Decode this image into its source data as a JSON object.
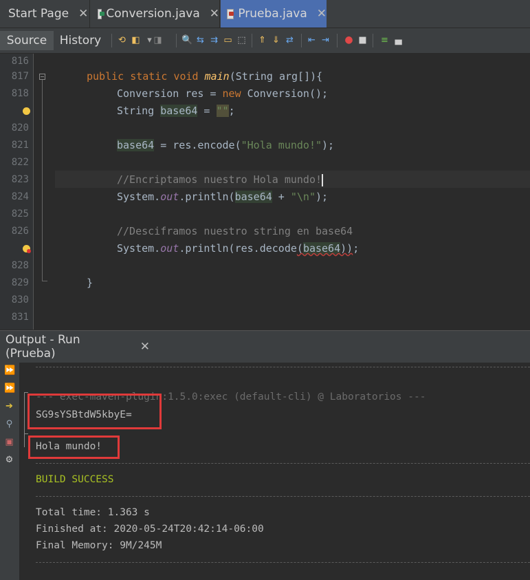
{
  "tabs": [
    {
      "label": "Start Page",
      "close": "✕"
    },
    {
      "label": "Conversion.java",
      "close": "✕"
    },
    {
      "label": "Prueba.java",
      "close": "✕"
    }
  ],
  "toolbar": {
    "source_label": "Source",
    "history_label": "History"
  },
  "editor": {
    "line_numbers": [
      "816",
      "817",
      "818",
      "",
      "820",
      "821",
      "822",
      "823",
      "824",
      "825",
      "826",
      "",
      "828",
      "829",
      "830",
      "831"
    ],
    "code": {
      "l817_kw": "public static void ",
      "l817_method": "main",
      "l817_rest": "(String arg[]){",
      "l818_a": "Conversion res = ",
      "l818_kw": "new",
      "l818_b": " Conversion();",
      "l819_a": "String ",
      "l819_var": "base64",
      "l819_b": " = ",
      "l819_str": "\"\"",
      "l819_c": ";",
      "l821_var": "base64",
      "l821_a": " = res.encode(",
      "l821_str": "\"Hola mundo!\"",
      "l821_b": ");",
      "l823_comment": "//Encriptamos nuestro Hola mundo!",
      "l824_a": "System.",
      "l824_out": "out",
      "l824_b": ".println(",
      "l824_var": "base64",
      "l824_c": " + ",
      "l824_str": "\"\\n\"",
      "l824_d": ");",
      "l826_comment": "//Desciframos nuestro string en base64",
      "l827_a": "System.",
      "l827_out": "out",
      "l827_b": ".println(res.decode",
      "l827_p1": "(",
      "l827_var": "base64",
      "l827_p2": "))",
      "l827_c": ";",
      "l829_brace": "}"
    }
  },
  "output": {
    "tab_label": "Output - Run (Prueba)",
    "tab_close": "✕",
    "lines": {
      "plugin": "--- exec-maven-plugin:1.5.0:exec (default-cli) @ Laboratorios ---",
      "encoded": "SG9sYSBtdW5kbyE=",
      "decoded": "Hola mundo!",
      "build": "BUILD SUCCESS",
      "total_time": "Total time: 1.363 s",
      "finished": "Finished at: 2020-05-24T20:42:14-06:00",
      "memory": "Final Memory: 9M/245M"
    },
    "side_icons": [
      "rerun-icon",
      "rerun-with-options-icon",
      "stop-arrow-icon",
      "inspect-icon",
      "clear-icon",
      "settings-icon"
    ]
  },
  "colors": {
    "accent": "#4b6eaf",
    "highlight_box": "#e03a3a",
    "success": "#a8c023"
  }
}
